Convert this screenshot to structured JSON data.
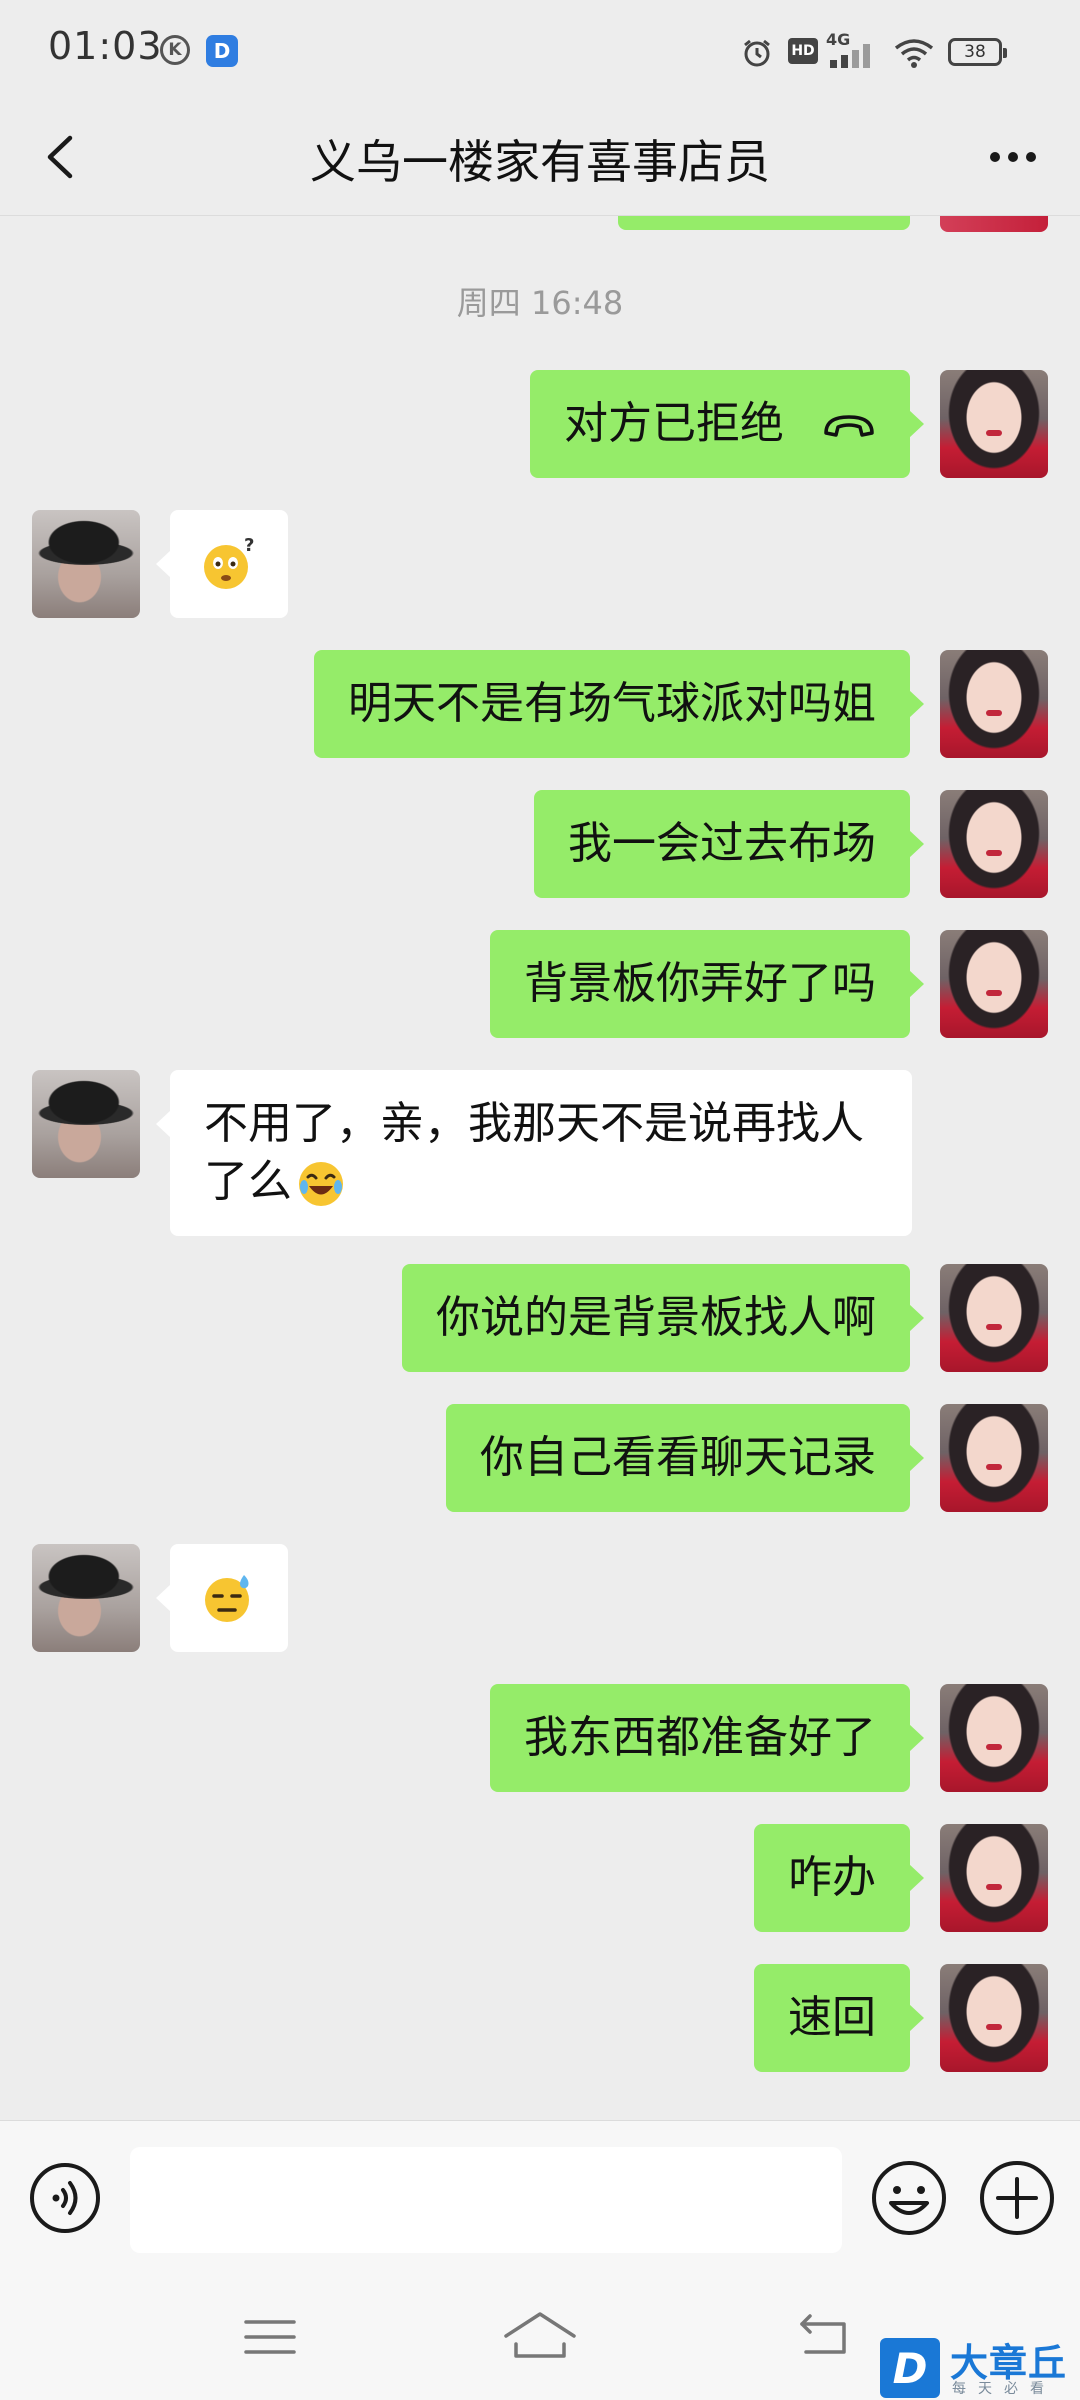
{
  "status_bar": {
    "time": "01:03",
    "k_badge": "K",
    "d_badge": "D",
    "hd": "HD",
    "network": "4G",
    "battery": "38"
  },
  "header": {
    "title": "义乌一楼家有喜事店员",
    "back_icon": "chevron-left-icon",
    "more_icon": "more-dots-icon"
  },
  "chat": {
    "timestamp": "周四 16:48",
    "messages": [
      {
        "side": "self",
        "text": "对方已拒绝",
        "icon": "call-declined-icon"
      },
      {
        "side": "other",
        "emoji": "thinking-face-emoji"
      },
      {
        "side": "self",
        "text": "明天不是有场气球派对吗姐"
      },
      {
        "side": "self",
        "text": "我一会过去布场"
      },
      {
        "side": "self",
        "text": "背景板你弄好了吗"
      },
      {
        "side": "other",
        "text": "不用了，亲，我那天不是说再找人了么",
        "emoji": "rolling-laughing-emoji"
      },
      {
        "side": "self",
        "text": "你说的是背景板找人啊"
      },
      {
        "side": "self",
        "text": "你自己看看聊天记录"
      },
      {
        "side": "other",
        "emoji": "sweat-face-emoji"
      },
      {
        "side": "self",
        "text": "我东西都准备好了"
      },
      {
        "side": "self",
        "text": "咋办"
      },
      {
        "side": "self",
        "text": "速回"
      }
    ]
  },
  "input_bar": {
    "value": "",
    "voice_icon": "voice-icon",
    "emoji_icon": "smiley-icon",
    "plus_icon": "plus-icon"
  },
  "watermark": {
    "logo_letter": "D",
    "name": "大章丘",
    "slogan": "每天必看"
  },
  "colors": {
    "background": "#ededed",
    "self_bubble": "#95ec69",
    "other_bubble": "#ffffff",
    "timestamp": "#9a9a9a",
    "watermark_blue": "#1a78d6"
  }
}
